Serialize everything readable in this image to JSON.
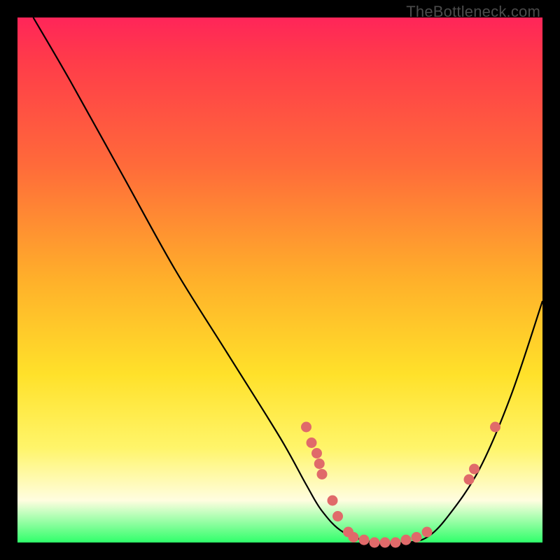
{
  "watermark": "TheBottleneck.com",
  "chart_data": {
    "type": "line",
    "title": "",
    "xlabel": "",
    "ylabel": "",
    "xlim": [
      0,
      100
    ],
    "ylim": [
      0,
      100
    ],
    "series": [
      {
        "name": "bottleneck-curve",
        "x": [
          3,
          10,
          20,
          30,
          40,
          50,
          55,
          58,
          62,
          68,
          74,
          78,
          82,
          88,
          94,
          100
        ],
        "y": [
          100,
          88,
          70,
          52,
          36,
          20,
          11,
          6,
          2,
          0,
          0,
          1,
          5,
          14,
          28,
          46
        ]
      }
    ],
    "scatter_points": {
      "name": "highlighted-points",
      "color": "#e06a6a",
      "points": [
        {
          "x": 55,
          "y": 22
        },
        {
          "x": 56,
          "y": 19
        },
        {
          "x": 57,
          "y": 17
        },
        {
          "x": 57.5,
          "y": 15
        },
        {
          "x": 58,
          "y": 13
        },
        {
          "x": 60,
          "y": 8
        },
        {
          "x": 61,
          "y": 5
        },
        {
          "x": 63,
          "y": 2
        },
        {
          "x": 64,
          "y": 1
        },
        {
          "x": 66,
          "y": 0.5
        },
        {
          "x": 68,
          "y": 0
        },
        {
          "x": 70,
          "y": 0
        },
        {
          "x": 72,
          "y": 0
        },
        {
          "x": 74,
          "y": 0.5
        },
        {
          "x": 76,
          "y": 1
        },
        {
          "x": 78,
          "y": 2
        },
        {
          "x": 86,
          "y": 12
        },
        {
          "x": 87,
          "y": 14
        },
        {
          "x": 91,
          "y": 22
        }
      ]
    }
  }
}
